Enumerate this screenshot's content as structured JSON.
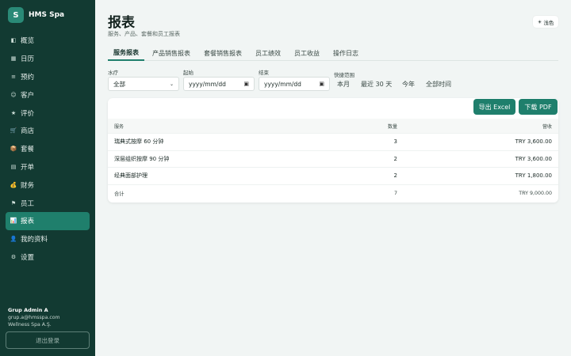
{
  "brand": {
    "logo_letter": "S",
    "name": "HMS Spa"
  },
  "sidebar": {
    "items": [
      {
        "label": "概览",
        "icon": "◧"
      },
      {
        "label": "日历",
        "icon": "▦"
      },
      {
        "label": "预约",
        "icon": "≡"
      },
      {
        "label": "客户",
        "icon": "☺"
      },
      {
        "label": "评价",
        "icon": "★"
      },
      {
        "label": "商店",
        "icon": "🛒"
      },
      {
        "label": "套餐",
        "icon": "📦"
      },
      {
        "label": "开单",
        "icon": "▤"
      },
      {
        "label": "财务",
        "icon": "💰"
      },
      {
        "label": "员工",
        "icon": "⚑"
      },
      {
        "label": "报表",
        "icon": "📊"
      },
      {
        "label": "我的资料",
        "icon": "👤"
      },
      {
        "label": "设置",
        "icon": "⚙"
      }
    ],
    "active_index": 10,
    "user": {
      "name": "Grup Admin A",
      "email": "grup.a@hmsspa.com",
      "company": "Wellness Spa A.Ş."
    },
    "logout_label": "退出登录"
  },
  "header": {
    "title": "报表",
    "subtitle": "服务、产品、套餐和员工报表",
    "theme_icon": "☀",
    "theme_label": "浅色"
  },
  "tabs": [
    {
      "label": "服务报表",
      "active": true
    },
    {
      "label": "产品销售报表",
      "active": false
    },
    {
      "label": "套餐销售报表",
      "active": false
    },
    {
      "label": "员工绩效",
      "active": false
    },
    {
      "label": "员工收益",
      "active": false
    },
    {
      "label": "操作日志",
      "active": false
    }
  ],
  "filters": {
    "therapy_label": "水疗",
    "therapy_value": "全部",
    "start_label": "起始",
    "start_placeholder": "yyyy/mm/dd",
    "end_label": "结束",
    "end_placeholder": "yyyy/mm/dd",
    "quick_label": "快捷范围",
    "quick_options": [
      "本月",
      "最近 30 天",
      "今年",
      "全部时间"
    ]
  },
  "actions": {
    "export_excel": "导出 Excel",
    "download_pdf": "下载 PDF"
  },
  "table": {
    "headers": {
      "service": "服务",
      "quantity": "数量",
      "revenue": "营收"
    },
    "rows": [
      {
        "service": "瑞典式按摩 60 分钟",
        "quantity": "3",
        "revenue": "TRY 3,600.00"
      },
      {
        "service": "深层组织按摩 90 分钟",
        "quantity": "2",
        "revenue": "TRY 3,600.00"
      },
      {
        "service": "经典面部护理",
        "quantity": "2",
        "revenue": "TRY 1,800.00"
      }
    ],
    "total": {
      "label": "合计",
      "quantity": "7",
      "revenue": "TRY 9,000.00"
    }
  },
  "colors": {
    "sidebar_bg": "#123a32",
    "accent": "#1f7f6c",
    "page_bg": "#f1f5f4"
  }
}
